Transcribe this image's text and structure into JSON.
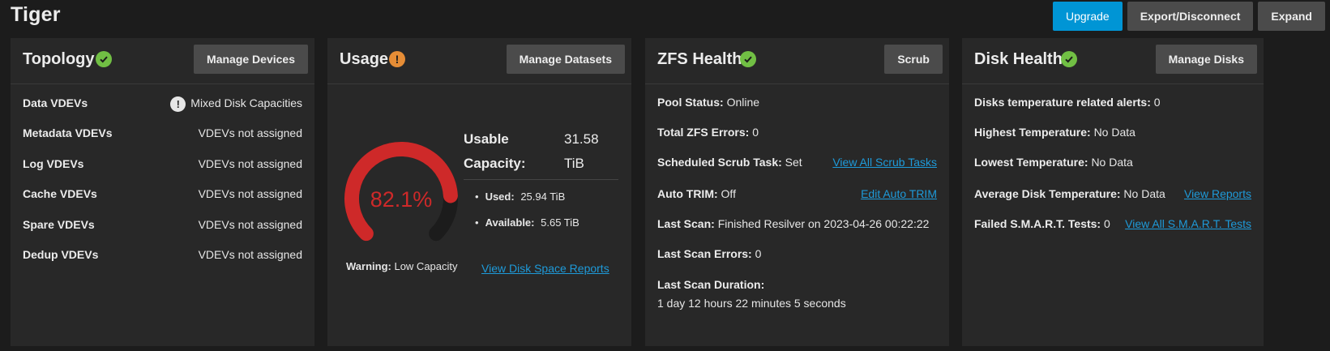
{
  "pool": {
    "name": "Tiger"
  },
  "top_actions": {
    "upgrade": "Upgrade",
    "export": "Export/Disconnect",
    "expand": "Expand"
  },
  "topology": {
    "title": "Topology",
    "button": "Manage Devices",
    "rows": [
      {
        "label": "Data VDEVs",
        "value": "Mixed Disk Capacities"
      },
      {
        "label": "Metadata VDEVs",
        "value": "VDEVs not assigned"
      },
      {
        "label": "Log VDEVs",
        "value": "VDEVs not assigned"
      },
      {
        "label": "Cache VDEVs",
        "value": "VDEVs not assigned"
      },
      {
        "label": "Spare VDEVs",
        "value": "VDEVs not assigned"
      },
      {
        "label": "Dedup VDEVs",
        "value": "VDEVs not assigned"
      }
    ]
  },
  "usage": {
    "title": "Usage",
    "button": "Manage Datasets",
    "percent_label": "82.1%",
    "percent_value": 82.1,
    "usable_label_1": "Usable",
    "usable_label_2": "Capacity:",
    "usable_value_1": "31.58",
    "usable_value_2": "TiB",
    "used_label": "Used:",
    "used_value": "25.94 TiB",
    "available_label": "Available:",
    "available_value": "5.65 TiB",
    "warning_label": "Warning:",
    "warning_value": "Low Capacity",
    "report_link": "View Disk Space Reports",
    "gauge_color": "#ce2929",
    "gauge_track_color": "#1c1c1c"
  },
  "zfs": {
    "title": "ZFS Health",
    "button": "Scrub",
    "pool_status_label": "Pool Status:",
    "pool_status_value": "Online",
    "errors_label": "Total ZFS Errors:",
    "errors_value": "0",
    "scrub_label": "Scheduled Scrub Task:",
    "scrub_value": "Set",
    "scrub_link": "View All Scrub Tasks",
    "trim_label": "Auto TRIM:",
    "trim_value": "Off",
    "trim_link": "Edit Auto TRIM",
    "last_scan_label": "Last Scan:",
    "last_scan_value": "Finished Resilver on 2023-04-26 00:22:22",
    "scan_errors_label": "Last Scan Errors:",
    "scan_errors_value": "0",
    "duration_label": "Last Scan Duration:",
    "duration_value": "1 day 12 hours 22 minutes 5 seconds"
  },
  "disk": {
    "title": "Disk Health",
    "button": "Manage Disks",
    "temp_alerts_label": "Disks temperature related alerts:",
    "temp_alerts_value": "0",
    "highest_label": "Highest Temperature:",
    "highest_value": "No Data",
    "lowest_label": "Lowest Temperature:",
    "lowest_value": "No Data",
    "average_label": "Average Disk Temperature:",
    "average_value": "No Data",
    "reports_link": "View Reports",
    "smart_label": "Failed S.M.A.R.T. Tests:",
    "smart_value": "0",
    "smart_link": "View All S.M.A.R.T. Tests"
  }
}
